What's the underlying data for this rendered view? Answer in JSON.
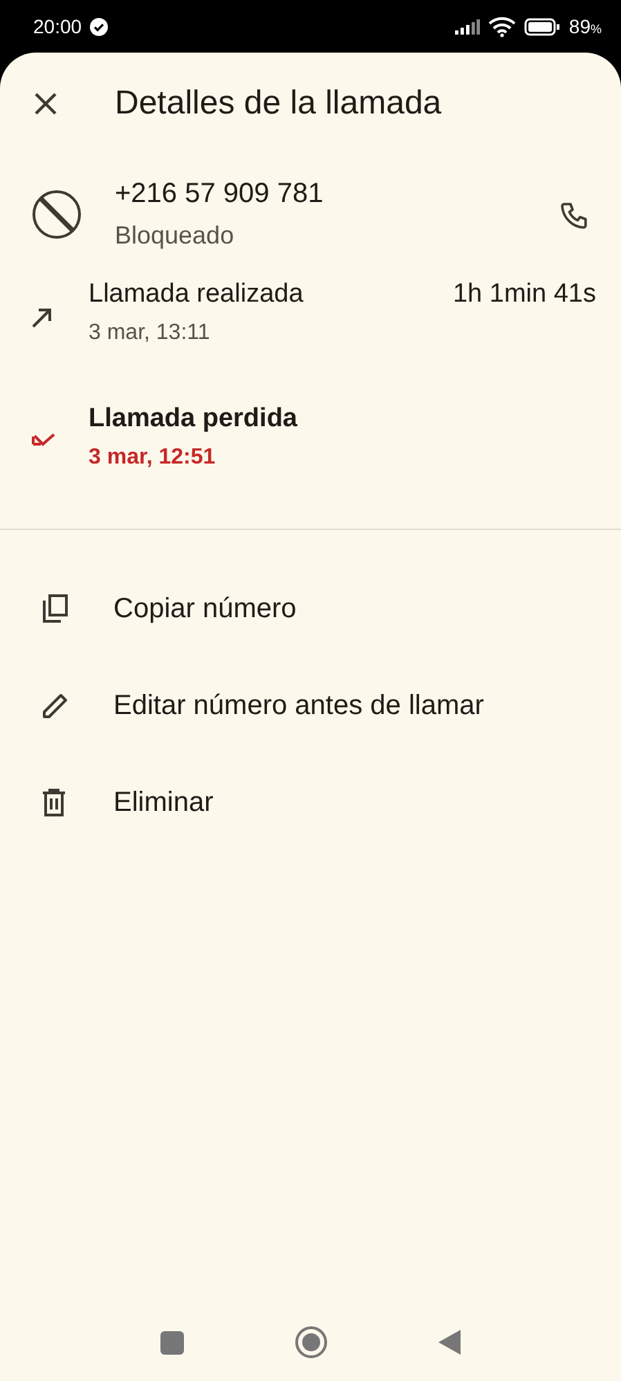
{
  "status_bar": {
    "time": "20:00",
    "battery_percent": "89",
    "battery_unit": "%"
  },
  "header": {
    "title": "Detalles de la llamada"
  },
  "contact": {
    "number": "+216 57 909 781",
    "status": "Bloqueado"
  },
  "calls": [
    {
      "kind": "outgoing",
      "title": "Llamada realizada",
      "date": "3 mar, 13:11",
      "duration": "1h 1min 41s"
    },
    {
      "kind": "missed",
      "title": "Llamada perdida",
      "date": "3 mar, 12:51"
    }
  ],
  "actions": [
    {
      "kind": "copy",
      "label": "Copiar número"
    },
    {
      "kind": "edit",
      "label": "Editar número antes de llamar"
    },
    {
      "kind": "delete",
      "label": "Eliminar"
    }
  ]
}
